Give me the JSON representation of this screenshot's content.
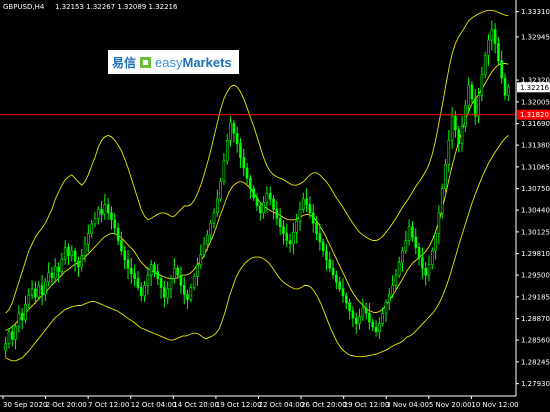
{
  "instrument": {
    "symbol_tf": "GBPUSD,H4",
    "ohlc": "1.32153 1.32267 1.32089 1.32216"
  },
  "logo": {
    "cn": "易信",
    "brand_light": "easy",
    "brand_bold": "Markets"
  },
  "colors": {
    "background": "#000000",
    "candle_up": "#00ff00",
    "candle_down": "#00ff00",
    "bands": "#e8e800",
    "level_line": "#ff0000",
    "axis": "#ffffff",
    "price_tag": "#ffffff",
    "level_tag": "#ff0000"
  },
  "chart_data": {
    "type": "candlestick",
    "y_ticks": [
      "1.33310",
      "1.32945",
      "1.32320",
      "1.32005",
      "1.31690",
      "1.31380",
      "1.31065",
      "1.30750",
      "1.30440",
      "1.30125",
      "1.29810",
      "1.29500",
      "1.29185",
      "1.28870",
      "1.28560",
      "1.28245",
      "1.27930"
    ],
    "ylim": [
      1.2778,
      1.3345
    ],
    "x_ticks": [
      "30 Sep 2020",
      "2 Oct 20:00",
      "7 Oct 12:00",
      "12 Oct 04:00",
      "14 Oct 20:00",
      "19 Oct 12:00",
      "22 Oct 04:00",
      "26 Oct 20:00",
      "29 Oct 12:00",
      "3 Nov 04:00",
      "5 Nov 20:00",
      "10 Nov 12:00"
    ],
    "current_price": "1.32216",
    "level_price": "1.31820",
    "level_label": "1.31820",
    "closes": [
      1.2851,
      1.2868,
      1.2857,
      1.2876,
      1.2895,
      1.2885,
      1.2908,
      1.2921,
      1.293,
      1.2918,
      1.2935,
      1.2922,
      1.294,
      1.2953,
      1.2946,
      1.2962,
      1.2955,
      1.2973,
      1.299,
      1.2978,
      1.2985,
      1.297,
      1.2962,
      1.2978,
      1.2995,
      1.301,
      1.3024,
      1.3032,
      1.3045,
      1.3038,
      1.3052,
      1.304,
      1.303,
      1.3018,
      1.3,
      1.2985,
      1.2972,
      1.296,
      1.2952,
      1.2945,
      1.2932,
      1.292,
      1.2935,
      1.295,
      1.2965,
      1.2955,
      1.2945,
      1.2932,
      1.2918,
      1.293,
      1.2945,
      1.296,
      1.295,
      1.2935,
      1.2922,
      1.2915,
      1.2932,
      1.2948,
      1.2965,
      1.298,
      1.2995,
      1.3008,
      1.3025,
      1.304,
      1.306,
      1.3085,
      1.3115,
      1.3145,
      1.317,
      1.3155,
      1.314,
      1.312,
      1.3105,
      1.309,
      1.3075,
      1.3062,
      1.305,
      1.304,
      1.3055,
      1.3068,
      1.306,
      1.3045,
      1.3032,
      1.302,
      1.301,
      1.3,
      1.2995,
      1.3012,
      1.3028,
      1.3045,
      1.306,
      1.3052,
      1.304,
      1.3025,
      1.301,
      1.2998,
      1.2985,
      1.2972,
      1.296,
      1.295,
      1.294,
      1.293,
      1.292,
      1.291,
      1.2898,
      1.2888,
      1.288,
      1.289,
      1.2902,
      1.2895,
      1.2882,
      1.2875,
      1.2868,
      1.288,
      1.2895,
      1.291,
      1.2922,
      1.2935,
      1.295,
      1.2968,
      1.2985,
      1.3,
      1.302,
      1.3005,
      1.299,
      1.2975,
      1.296,
      1.295,
      1.2965,
      1.2985,
      1.301,
      1.304,
      1.3075,
      1.311,
      1.3145,
      1.318,
      1.316,
      1.314,
      1.3165,
      1.3195,
      1.3225,
      1.3205,
      1.318,
      1.321,
      1.324,
      1.3268,
      1.329,
      1.3305,
      1.3285,
      1.326,
      1.3235,
      1.321,
      1.3222
    ],
    "bands": {
      "upper": [
        1.2895,
        1.29,
        1.291,
        1.2925,
        1.294,
        1.2955,
        1.297,
        1.2985,
        1.2995,
        1.3005,
        1.3012,
        1.3018,
        1.3025,
        1.3035,
        1.3045,
        1.306,
        1.307,
        1.308,
        1.3088,
        1.3092,
        1.3095,
        1.309,
        1.3085,
        1.308,
        1.3085,
        1.3095,
        1.3108,
        1.312,
        1.3135,
        1.3145,
        1.315,
        1.3152,
        1.315,
        1.3145,
        1.3138,
        1.313,
        1.3118,
        1.3105,
        1.309,
        1.3075,
        1.306,
        1.3045,
        1.3035,
        1.303,
        1.3032,
        1.3035,
        1.3038,
        1.304,
        1.304,
        1.3038,
        1.3035,
        1.3035,
        1.304,
        1.3045,
        1.305,
        1.305,
        1.3052,
        1.3058,
        1.3068,
        1.308,
        1.3095,
        1.3112,
        1.313,
        1.315,
        1.317,
        1.319,
        1.3205,
        1.3215,
        1.3222,
        1.3225,
        1.3222,
        1.3215,
        1.3205,
        1.3192,
        1.3178,
        1.3165,
        1.315,
        1.3135,
        1.312,
        1.3108,
        1.31,
        1.3095,
        1.3092,
        1.309,
        1.3088,
        1.3085,
        1.3082,
        1.308,
        1.308,
        1.3082,
        1.3085,
        1.309,
        1.3095,
        1.3098,
        1.3098,
        1.3095,
        1.309,
        1.3085,
        1.3078,
        1.307,
        1.3062,
        1.3055,
        1.3048,
        1.304,
        1.3032,
        1.3025,
        1.3018,
        1.3012,
        1.3008,
        1.3005,
        1.3002,
        1.3,
        1.3,
        1.3002,
        1.3006,
        1.3012,
        1.3018,
        1.3025,
        1.3032,
        1.304,
        1.3048,
        1.3055,
        1.3062,
        1.307,
        1.3078,
        1.3085,
        1.3092,
        1.31,
        1.311,
        1.3125,
        1.3145,
        1.317,
        1.3195,
        1.3222,
        1.3248,
        1.327,
        1.3285,
        1.3295,
        1.3302,
        1.331,
        1.3318,
        1.3322,
        1.3325,
        1.3328,
        1.333,
        1.3332,
        1.3333,
        1.3333,
        1.3332,
        1.333,
        1.3328,
        1.3326,
        1.3325
      ],
      "middle": [
        1.287,
        1.2872,
        1.2875,
        1.288,
        1.2885,
        1.289,
        1.2895,
        1.29,
        1.2905,
        1.291,
        1.2915,
        1.292,
        1.2925,
        1.293,
        1.2935,
        1.294,
        1.2945,
        1.295,
        1.2955,
        1.2958,
        1.2962,
        1.2965,
        1.2968,
        1.297,
        1.2975,
        1.298,
        1.2985,
        1.299,
        1.2995,
        1.3,
        1.3005,
        1.3008,
        1.301,
        1.301,
        1.3008,
        1.3005,
        1.3,
        1.2995,
        1.299,
        1.2985,
        1.2978,
        1.297,
        1.2965,
        1.296,
        1.2958,
        1.2955,
        1.2952,
        1.295,
        1.2948,
        1.2946,
        1.2945,
        1.2945,
        1.2946,
        1.2948,
        1.295,
        1.295,
        1.2952,
        1.2956,
        1.2962,
        1.2968,
        1.2975,
        1.2985,
        1.2995,
        1.3005,
        1.3018,
        1.3032,
        1.3045,
        1.3058,
        1.307,
        1.3078,
        1.3082,
        1.3085,
        1.3085,
        1.3082,
        1.3078,
        1.3072,
        1.3065,
        1.3058,
        1.3052,
        1.3048,
        1.3045,
        1.3042,
        1.304,
        1.3038,
        1.3035,
        1.3032,
        1.303,
        1.303,
        1.303,
        1.3032,
        1.3035,
        1.3037,
        1.3038,
        1.3036,
        1.3032,
        1.3026,
        1.3018,
        1.301,
        1.3,
        1.299,
        1.298,
        1.297,
        1.296,
        1.295,
        1.294,
        1.293,
        1.2922,
        1.2915,
        1.291,
        1.2905,
        1.29,
        1.2898,
        1.2896,
        1.2896,
        1.2898,
        1.2902,
        1.2908,
        1.2915,
        1.2922,
        1.293,
        1.2938,
        1.2946,
        1.2955,
        1.2962,
        1.2968,
        1.2972,
        1.2976,
        1.298,
        1.2985,
        1.2992,
        1.3002,
        1.3015,
        1.303,
        1.3048,
        1.3068,
        1.309,
        1.311,
        1.3128,
        1.3145,
        1.316,
        1.3175,
        1.3188,
        1.3198,
        1.3205,
        1.3212,
        1.322,
        1.3228,
        1.3236,
        1.3244,
        1.325,
        1.3254,
        1.3256,
        1.3256,
        1.3255
      ],
      "lower": [
        1.283,
        1.2828,
        1.2826,
        1.2826,
        1.2828,
        1.283,
        1.2835,
        1.284,
        1.2846,
        1.2852,
        1.2858,
        1.2864,
        1.287,
        1.2876,
        1.2882,
        1.2888,
        1.2892,
        1.2896,
        1.29,
        1.2902,
        1.2904,
        1.2905,
        1.2906,
        1.2906,
        1.2908,
        1.291,
        1.2912,
        1.2912,
        1.291,
        1.2908,
        1.2906,
        1.2904,
        1.2902,
        1.29,
        1.2898,
        1.2895,
        1.2892,
        1.2888,
        1.2885,
        1.2882,
        1.2878,
        1.2874,
        1.2872,
        1.287,
        1.2868,
        1.2866,
        1.2864,
        1.2862,
        1.286,
        1.2858,
        1.2856,
        1.2856,
        1.2858,
        1.286,
        1.2862,
        1.2862,
        1.2864,
        1.2866,
        1.2866,
        1.2864,
        1.286,
        1.2858,
        1.286,
        1.2862,
        1.2866,
        1.2872,
        1.2885,
        1.29,
        1.2918,
        1.2932,
        1.2945,
        1.2955,
        1.2962,
        1.2968,
        1.2972,
        1.2975,
        1.2976,
        1.2976,
        1.2975,
        1.2972,
        1.2968,
        1.2962,
        1.2955,
        1.2948,
        1.2942,
        1.2938,
        1.2935,
        1.2932,
        1.293,
        1.293,
        1.2932,
        1.2935,
        1.2935,
        1.2932,
        1.2926,
        1.2918,
        1.2908,
        1.2896,
        1.2884,
        1.2872,
        1.2862,
        1.2852,
        1.2845,
        1.284,
        1.2836,
        1.2834,
        1.2833,
        1.2832,
        1.2832,
        1.2832,
        1.2833,
        1.2834,
        1.2835,
        1.2836,
        1.2838,
        1.284,
        1.2842,
        1.2845,
        1.2848,
        1.285,
        1.2852,
        1.2855,
        1.286,
        1.2862,
        1.2865,
        1.287,
        1.2875,
        1.288,
        1.2885,
        1.289,
        1.2895,
        1.2902,
        1.291,
        1.292,
        1.2932,
        1.2946,
        1.2962,
        1.2978,
        1.2995,
        1.301,
        1.3025,
        1.304,
        1.3055,
        1.3068,
        1.308,
        1.3092,
        1.3102,
        1.3112,
        1.312,
        1.3128,
        1.3135,
        1.3142,
        1.3148,
        1.3152
      ]
    }
  }
}
